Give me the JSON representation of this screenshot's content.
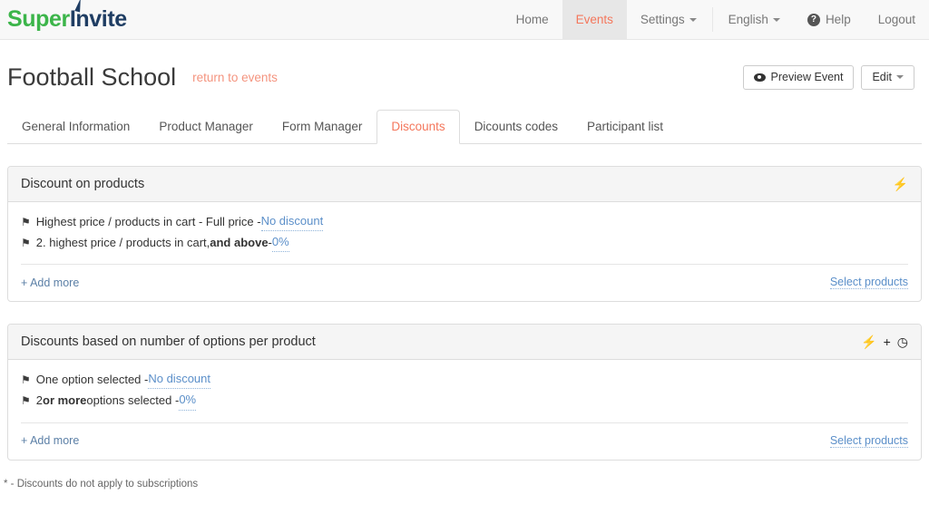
{
  "brand": {
    "part1": "Super",
    "part2": "Invite"
  },
  "nav": {
    "items": [
      {
        "label": "Home",
        "active": false,
        "caret": false
      },
      {
        "label": "Events",
        "active": true,
        "caret": false
      },
      {
        "label": "Settings",
        "active": false,
        "caret": true
      }
    ],
    "right_items": [
      {
        "label": "English",
        "caret": true,
        "icon": ""
      },
      {
        "label": "Help",
        "caret": false,
        "icon": "question-circle-icon",
        "icon_glyph": "?"
      },
      {
        "label": "Logout",
        "caret": false,
        "icon": ""
      }
    ]
  },
  "header": {
    "title": "Football School",
    "return_link": "return to events",
    "preview_button": "Preview Event",
    "edit_button": "Edit"
  },
  "tabs": [
    {
      "label": "General Information",
      "active": false
    },
    {
      "label": "Product Manager",
      "active": false
    },
    {
      "label": "Form Manager",
      "active": false
    },
    {
      "label": "Discounts",
      "active": true
    },
    {
      "label": "Dicounts codes",
      "active": false
    },
    {
      "label": "Participant list",
      "active": false
    }
  ],
  "panels": [
    {
      "title": "Discount on products",
      "icons": [
        {
          "name": "lightning-icon",
          "glyph": "⚡"
        }
      ],
      "rules": [
        {
          "flag": "⚑",
          "pre": "Highest price / products in cart - Full price - ",
          "bold": "",
          "mid": "",
          "link": "No discount",
          "post": ""
        },
        {
          "flag": "⚑",
          "pre": "2. highest price / products in cart, ",
          "bold": "and above",
          "mid": " - ",
          "link": "0%",
          "post": ""
        }
      ],
      "add_more": "+ Add more",
      "select_products": "Select products"
    },
    {
      "title": "Discounts based on number of options per product",
      "icons": [
        {
          "name": "lightning-icon",
          "glyph": "⚡"
        },
        {
          "name": "plus-icon",
          "glyph": "+"
        },
        {
          "name": "clock-icon",
          "glyph": "◷"
        }
      ],
      "rules": [
        {
          "flag": "⚑",
          "pre": "One option selected - ",
          "bold": "",
          "mid": "",
          "link": "No discount",
          "post": ""
        },
        {
          "flag": "⚑",
          "pre": "2 ",
          "bold": "or more",
          "mid": " options selected - ",
          "link": "0%",
          "post": ""
        }
      ],
      "add_more": "+ Add more",
      "select_products": "Select products"
    }
  ],
  "footnote": "* - Discounts do not apply to subscriptions",
  "colors": {
    "accent": "#f4775c",
    "brand_green": "#3cb54a",
    "brand_navy": "#1f3d63",
    "link_blue": "#5b8fc9"
  }
}
